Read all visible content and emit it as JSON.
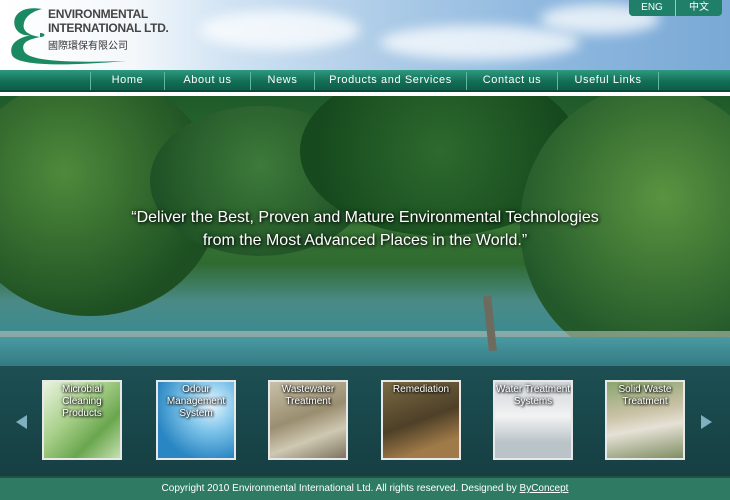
{
  "logo": {
    "line1": "ENVIRONMENTAL",
    "line2": "INTERNATIONAL LTD.",
    "chinese": "國際環保有限公司"
  },
  "language": {
    "eng": "ENG",
    "chinese": "中文"
  },
  "nav": {
    "items": [
      {
        "label": "Home"
      },
      {
        "label": "About us"
      },
      {
        "label": "News"
      },
      {
        "label": "Products and Services"
      },
      {
        "label": "Contact us"
      },
      {
        "label": "Useful Links"
      }
    ]
  },
  "hero": {
    "quote_line1": "“Deliver the Best, Proven and Mature Environmental Technologies",
    "quote_line2": "from the Most Advanced Places in the World.”"
  },
  "products": [
    {
      "label_line1": "Microbial",
      "label_line2": "Cleaning",
      "label_line3": "Products"
    },
    {
      "label_line1": "Odour",
      "label_line2": "Management",
      "label_line3": "System"
    },
    {
      "label_line1": "Wastewater",
      "label_line2": "Treatment",
      "label_line3": ""
    },
    {
      "label_line1": "Remediation",
      "label_line2": "",
      "label_line3": ""
    },
    {
      "label_line1": "Water Treatment",
      "label_line2": "Systems",
      "label_line3": ""
    },
    {
      "label_line1": "Solid Waste",
      "label_line2": "Treatment",
      "label_line3": ""
    }
  ],
  "footer": {
    "text": "Copyright 2010 Environmental International Ltd. All rights reserved. Designed by",
    "link": "ByConcept"
  },
  "colors": {
    "brand_green": "#137058",
    "footer_green": "#2f7a62",
    "strip": "#1c4f53"
  }
}
